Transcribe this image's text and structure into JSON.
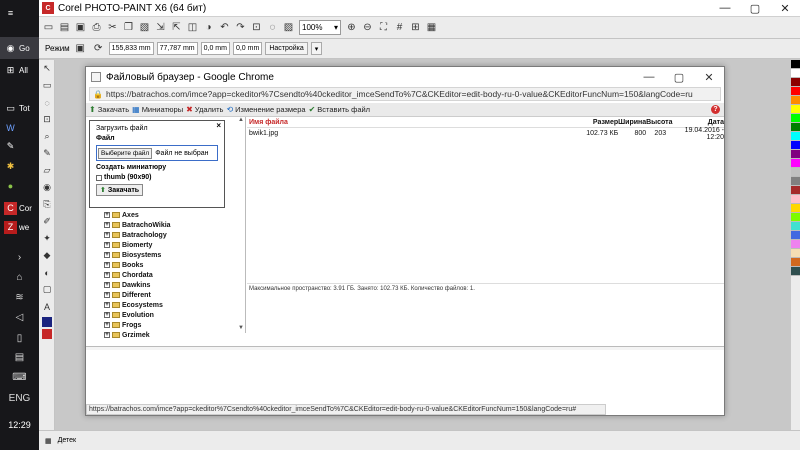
{
  "taskbar": {
    "items": [
      {
        "label": "Go",
        "icon": "chrome-icon"
      },
      {
        "label": "All",
        "icon": "windows-icon"
      },
      {
        "label": "Tot",
        "icon": "monitor-icon"
      },
      {
        "label": "",
        "icon": "word-icon"
      },
      {
        "label": "",
        "icon": "tool-icon"
      },
      {
        "label": "",
        "icon": "network-icon"
      },
      {
        "label": "",
        "icon": "app-icon"
      },
      {
        "label": "Cor",
        "icon": "corel-icon"
      },
      {
        "label": "we",
        "icon": "filezilla-icon"
      }
    ],
    "language": "ENG",
    "clock": "12:29"
  },
  "app": {
    "title": "Corel PHOTO-PAINT X6 (64 бит)",
    "zoom": "100%",
    "mode_label": "Режим",
    "coord_x": "155,833 mm",
    "coord_y": "77,787 mm",
    "offset_x": "0,0 mm",
    "offset_y": "0,0 mm",
    "settings_label": "Настройка",
    "status_tab": "Детек"
  },
  "chrome": {
    "title": "Файловый браузер - Google Chrome",
    "url": "https://batrachos.com/imce?app=ckeditor%7Csendto%40ckeditor_imceSendTo%7C&CKEditor=edit-body-ru-0-value&CKEditorFuncNum=150&langCode=ru",
    "status_url": "https://batrachos.com/imce?app=ckeditor%7Csendto%40ckeditor_imceSendTo%7C&CKEditor=edit-body-ru-0-value&CKEditorFuncNum=150&langCode=ru#"
  },
  "imce": {
    "toolbar": {
      "upload": "Закачать",
      "thumbnails": "Миниатюры",
      "delete": "Удалить",
      "resize": "Изменение размера",
      "insert": "Вставить файл"
    },
    "upload_panel": {
      "heading": "Загрузить файл",
      "file_label": "Файл",
      "choose_button": "Выберите файл",
      "no_file": "Файл не выбран",
      "create_thumb": "Создать миниатюру",
      "thumb_option": "thumb (90x90)",
      "submit": "Закачать"
    },
    "folders": [
      "Axes",
      "BatrachoWikia",
      "Batrachology",
      "Biomerty",
      "Biosystems",
      "Books",
      "Chordata",
      "Dawkins",
      "Different",
      "Ecosystems",
      "Evolution",
      "Frogs",
      "Grzimek"
    ],
    "columns": {
      "name": "Имя файла",
      "size": "Размер",
      "width": "Ширина",
      "height": "Высота",
      "date": "Дата"
    },
    "files": [
      {
        "name": "bwik1.jpg",
        "size": "102.73 КБ",
        "width": "800",
        "height": "203",
        "date": "19.04.2016 - 12:20"
      }
    ],
    "status": "Максимальное пространство: 3.91 ГБ. Занято: 102.73 КБ. Количество файлов: 1."
  },
  "palette_colors": [
    "#000000",
    "#ffffff",
    "#8b0000",
    "#ff0000",
    "#ff8c00",
    "#ffff00",
    "#00ff00",
    "#008000",
    "#00ffff",
    "#0000ff",
    "#800080",
    "#ff00ff",
    "#c0c0c0",
    "#808080",
    "#a52a2a",
    "#ffc0cb",
    "#ffd700",
    "#7cfc00",
    "#40e0d0",
    "#4169e1",
    "#ee82ee",
    "#f5deb3",
    "#d2691e",
    "#2f4f4f"
  ]
}
